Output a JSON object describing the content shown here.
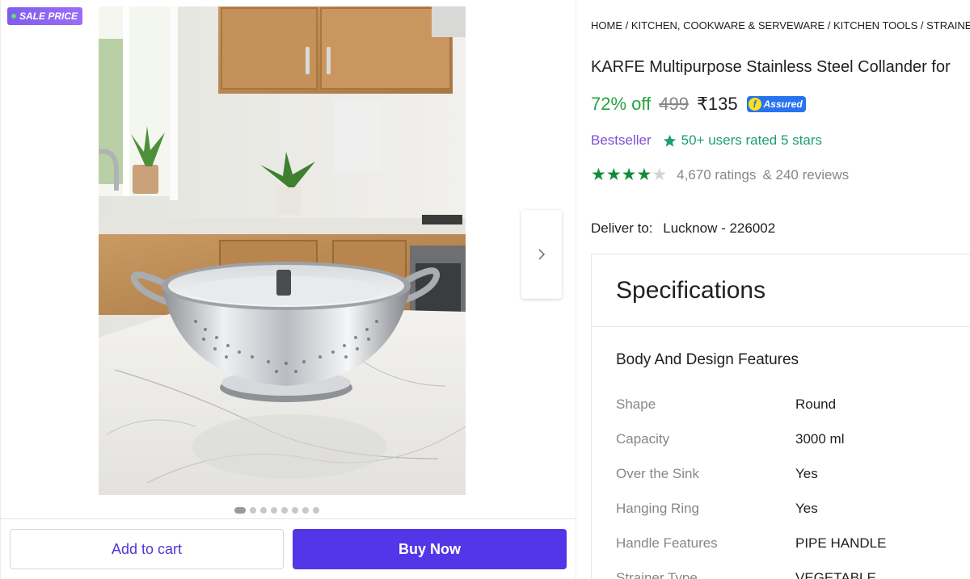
{
  "badge": {
    "label": "SALE PRICE"
  },
  "gallery": {
    "dots_total": 8,
    "active_index": 0
  },
  "actions": {
    "add_to_cart": "Add to cart",
    "buy_now": "Buy Now"
  },
  "breadcrumb": "HOME / KITCHEN, COOKWARE & SERVEWARE / KITCHEN TOOLS / STRAINERS &",
  "product": {
    "title": "KARFE Multipurpose Stainless Steel Collander for",
    "discount": "72% off",
    "mrp": "499",
    "price": "₹135",
    "assured_label": "Assured"
  },
  "highlights": {
    "bestseller": "Bestseller",
    "users_rated": "50+ users rated 5 stars"
  },
  "rating": {
    "stars": 4,
    "max_stars": 5,
    "ratings_text": "4,670 ratings",
    "reviews_text": "& 240 reviews"
  },
  "delivery": {
    "label": "Deliver to:",
    "location": "Lucknow - 226002"
  },
  "specifications": {
    "heading": "Specifications",
    "group": "Body And Design Features",
    "rows": [
      {
        "key": "Shape",
        "value": "Round"
      },
      {
        "key": "Capacity",
        "value": "3000 ml"
      },
      {
        "key": "Over the Sink",
        "value": "Yes"
      },
      {
        "key": "Hanging Ring",
        "value": "Yes"
      },
      {
        "key": "Handle Features",
        "value": "PIPE HANDLE"
      },
      {
        "key": "Strainer Type",
        "value": "VEGETABLE"
      }
    ]
  },
  "colors": {
    "accent": "#5336e8",
    "discount_green": "#26a541",
    "star_green": "#138a3a",
    "bestseller_purple": "#7e4fd6",
    "assured_blue": "#2874f0"
  }
}
